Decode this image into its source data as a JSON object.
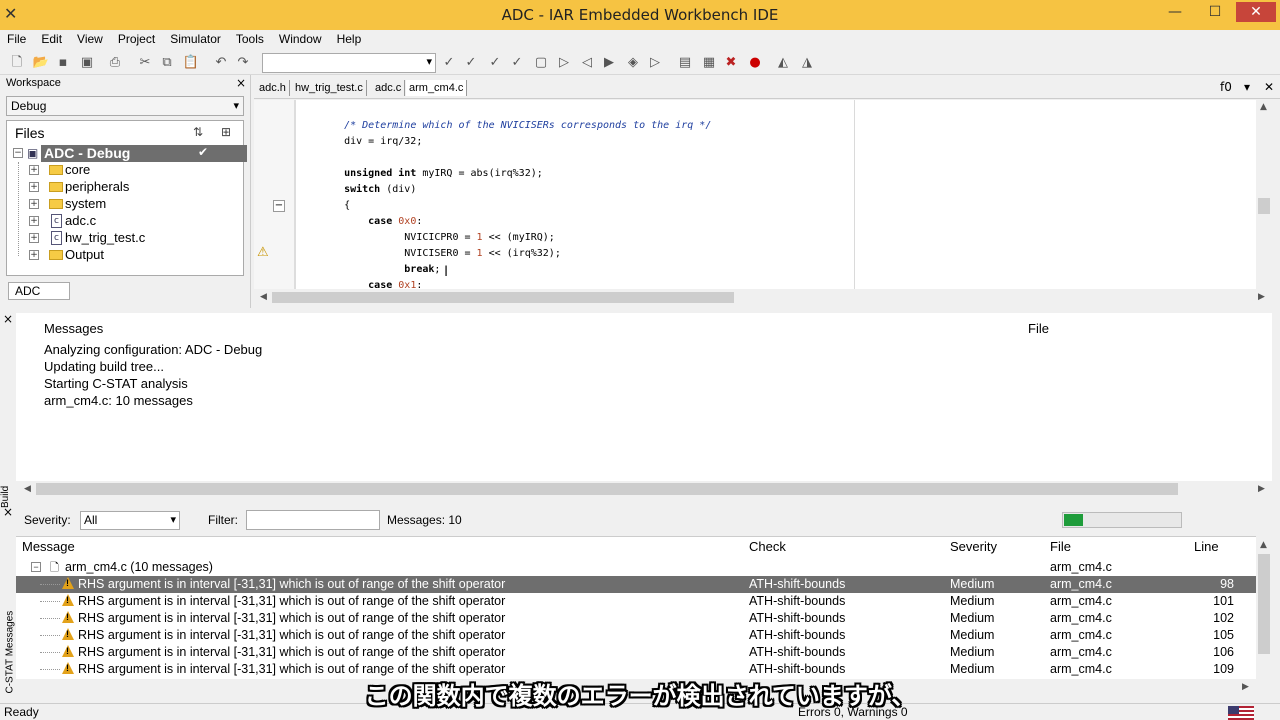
{
  "window": {
    "title": "ADC - IAR Embedded Workbench IDE",
    "minimize": "—",
    "maximize": "☐",
    "close": "✕"
  },
  "menu": [
    "File",
    "Edit",
    "View",
    "Project",
    "Simulator",
    "Tools",
    "Window",
    "Help"
  ],
  "toolbar": {
    "combo_value": "",
    "icons": [
      "new-file-icon",
      "open-icon",
      "save-icon",
      "save-all-icon",
      "print-icon",
      "cut-icon",
      "copy-icon",
      "paste-icon",
      "undo-icon",
      "redo-icon",
      "find-icon",
      "find-next-icon",
      "find-prev-icon",
      "replace-icon",
      "goto-icon",
      "bookmark-icon",
      "bookmark-next-icon",
      "bookmark-prev-icon",
      "nav-back-icon",
      "nav-forward-icon",
      "compile-icon",
      "make-icon",
      "stop-build-icon",
      "breakpoint-icon",
      "download-debug-icon",
      "debug-no-download-icon"
    ]
  },
  "workspace": {
    "title": "Workspace",
    "close": "×",
    "config": "Debug",
    "files_label": "Files",
    "root": {
      "label": "ADC - Debug",
      "check": "✔"
    },
    "items": [
      {
        "label": "core",
        "type": "folder"
      },
      {
        "label": "peripherals",
        "type": "folder"
      },
      {
        "label": "system",
        "type": "folder"
      },
      {
        "label": "adc.c",
        "type": "file"
      },
      {
        "label": "hw_trig_test.c",
        "type": "file"
      },
      {
        "label": "Output",
        "type": "folder"
      }
    ],
    "tab": "ADC"
  },
  "editor": {
    "tabs": [
      "adc.h",
      "hw_trig_test.c",
      "adc.c",
      "arm_cm4.c"
    ],
    "active_tab": 3,
    "func_label": "f0",
    "code": [
      {
        "segments": [
          {
            "t": "    ",
            "c": ""
          },
          {
            "t": "/* Determine which of the NVICISERs corresponds to the irq */",
            "c": "cm"
          }
        ]
      },
      {
        "segments": [
          {
            "t": "    div = irq/32;",
            "c": ""
          }
        ]
      },
      {
        "segments": [
          {
            "t": "",
            "c": ""
          }
        ]
      },
      {
        "segments": [
          {
            "t": "    unsigned int",
            "c": "kw"
          },
          {
            "t": " myIRQ = abs(irq%32);",
            "c": ""
          }
        ]
      },
      {
        "segments": [
          {
            "t": "    switch",
            "c": "kw"
          },
          {
            "t": " (div)",
            "c": ""
          }
        ]
      },
      {
        "segments": [
          {
            "t": "    {",
            "c": ""
          }
        ]
      },
      {
        "segments": [
          {
            "t": "        case",
            "c": "kw"
          },
          {
            "t": " ",
            "c": ""
          },
          {
            "t": "0x0",
            "c": "num"
          },
          {
            "t": ":",
            "c": ""
          }
        ]
      },
      {
        "segments": [
          {
            "t": "              NVICICPR0 = ",
            "c": ""
          },
          {
            "t": "1",
            "c": "num"
          },
          {
            "t": " << (myIRQ);",
            "c": ""
          }
        ]
      },
      {
        "segments": [
          {
            "t": "              NVICISER0 = ",
            "c": ""
          },
          {
            "t": "1",
            "c": "num"
          },
          {
            "t": " << (irq%32);",
            "c": ""
          }
        ]
      },
      {
        "segments": [
          {
            "t": "              break",
            "c": "kw"
          },
          {
            "t": ";",
            "c": ""
          }
        ]
      },
      {
        "segments": [
          {
            "t": "        case",
            "c": "kw"
          },
          {
            "t": " ",
            "c": ""
          },
          {
            "t": "0x1",
            "c": "num"
          },
          {
            "t": ":",
            "c": ""
          }
        ]
      }
    ]
  },
  "build": {
    "side_label": "Build",
    "header_messages": "Messages",
    "header_file": "File",
    "lines": [
      "Analyzing configuration: ADC - Debug",
      "Updating build tree...",
      "Starting C-STAT analysis",
      "arm_cm4.c: 10 messages"
    ]
  },
  "cstat": {
    "side_label": "C-STAT Messages",
    "severity_label": "Severity:",
    "severity_value": "All",
    "filter_label": "Filter:",
    "filter_value": "",
    "messages_count": "Messages: 10",
    "progress_fraction": 0.16,
    "columns": [
      "Message",
      "Check",
      "Severity",
      "File",
      "Line"
    ],
    "group": {
      "label": "arm_cm4.c  (10 messages)",
      "file": "arm_cm4.c"
    },
    "rows": [
      {
        "message": "RHS argument is in interval [-31,31] which is out of range of the shift operator",
        "check": "ATH-shift-bounds",
        "severity": "Medium",
        "file": "arm_cm4.c",
        "line": "98"
      },
      {
        "message": "RHS argument is in interval [-31,31] which is out of range of the shift operator",
        "check": "ATH-shift-bounds",
        "severity": "Medium",
        "file": "arm_cm4.c",
        "line": "101"
      },
      {
        "message": "RHS argument is in interval [-31,31] which is out of range of the shift operator",
        "check": "ATH-shift-bounds",
        "severity": "Medium",
        "file": "arm_cm4.c",
        "line": "102"
      },
      {
        "message": "RHS argument is in interval [-31,31] which is out of range of the shift operator",
        "check": "ATH-shift-bounds",
        "severity": "Medium",
        "file": "arm_cm4.c",
        "line": "105"
      },
      {
        "message": "RHS argument is in interval [-31,31] which is out of range of the shift operator",
        "check": "ATH-shift-bounds",
        "severity": "Medium",
        "file": "arm_cm4.c",
        "line": "106"
      },
      {
        "message": "RHS argument is in interval [-31,31] which is out of range of the shift operator",
        "check": "ATH-shift-bounds",
        "severity": "Medium",
        "file": "arm_cm4.c",
        "line": "109"
      }
    ],
    "selected_row": 0
  },
  "status": {
    "left": "Ready",
    "right": "Errors 0, Warnings 0"
  },
  "subtitle": "この関数内で複数のエラーが検出されていますが、",
  "colors": {
    "titlebar": "#f6c342",
    "selection": "#6e6e6e",
    "progress": "#1e9c3a",
    "warning": "#e3a21a"
  }
}
